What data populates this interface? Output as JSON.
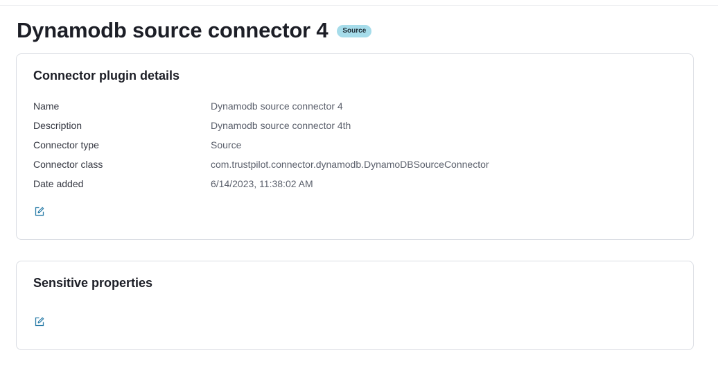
{
  "header": {
    "title": "Dynamodb source connector 4",
    "badge": "Source"
  },
  "details_panel": {
    "title": "Connector plugin details",
    "rows": [
      {
        "label": "Name",
        "value": "Dynamodb source connector 4"
      },
      {
        "label": "Description",
        "value": "Dynamodb source connector 4th"
      },
      {
        "label": "Connector type",
        "value": "Source"
      },
      {
        "label": "Connector class",
        "value": "com.trustpilot.connector.dynamodb.DynamoDBSourceConnector"
      },
      {
        "label": "Date added",
        "value": "6/14/2023, 11:38:02 AM"
      }
    ],
    "edit_icon": "edit-icon"
  },
  "sensitive_panel": {
    "title": "Sensitive properties",
    "edit_icon": "edit-icon"
  },
  "colors": {
    "badge_bg": "#a6dcea",
    "icon_accent": "#2b7da8",
    "border": "#dadde3"
  }
}
